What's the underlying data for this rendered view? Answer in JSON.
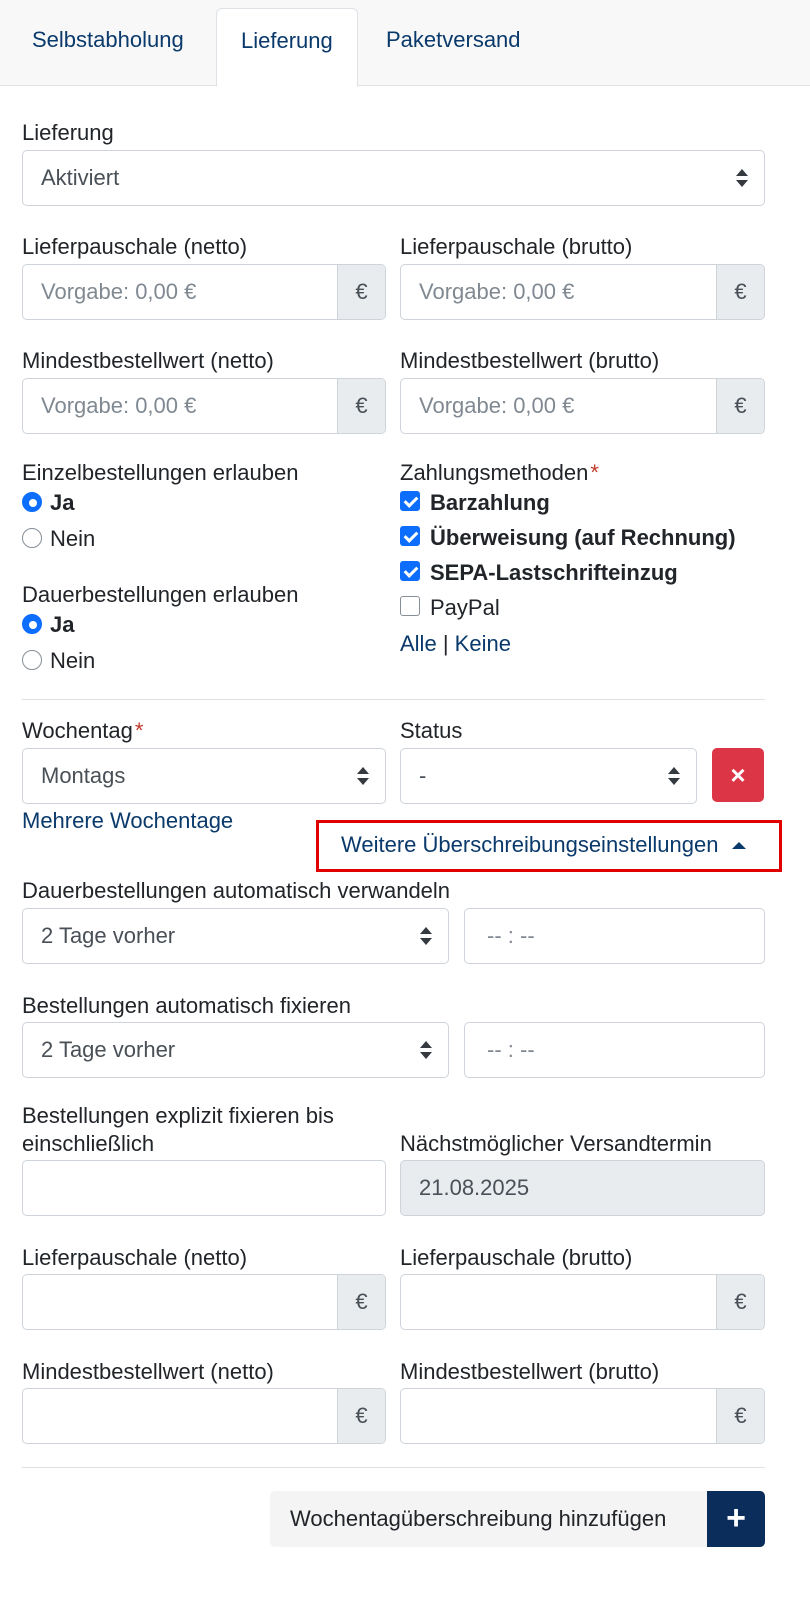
{
  "tabs": [
    {
      "label": "Selbstabholung",
      "active": false
    },
    {
      "label": "Lieferung",
      "active": true
    },
    {
      "label": "Paketversand",
      "active": false
    }
  ],
  "lieferung": {
    "label": "Lieferung",
    "value": "Aktiviert"
  },
  "defaults": {
    "lieferpauschale_netto": {
      "label": "Lieferpauschale (netto)",
      "placeholder": "Vorgabe: 0,00 €",
      "unit": "€"
    },
    "lieferpauschale_brutto": {
      "label": "Lieferpauschale (brutto)",
      "placeholder": "Vorgabe: 0,00 €",
      "unit": "€"
    },
    "mindestbestellwert_netto": {
      "label": "Mindestbestellwert (netto)",
      "placeholder": "Vorgabe: 0,00 €",
      "unit": "€"
    },
    "mindestbestellwert_brutto": {
      "label": "Mindestbestellwert (brutto)",
      "placeholder": "Vorgabe: 0,00 €",
      "unit": "€"
    }
  },
  "einzelbestellungen": {
    "label": "Einzelbestellungen erlauben",
    "options": [
      "Ja",
      "Nein"
    ],
    "selected": "Ja"
  },
  "dauerbestellungen": {
    "label": "Dauerbestellungen erlauben",
    "options": [
      "Ja",
      "Nein"
    ],
    "selected": "Ja"
  },
  "zahlungsmethoden": {
    "label": "Zahlungsmethoden",
    "required_mark": "*",
    "options": [
      {
        "label": "Barzahlung",
        "checked": true
      },
      {
        "label": "Überweisung (auf Rechnung)",
        "checked": true
      },
      {
        "label": "SEPA-Lastschrifteinzug",
        "checked": true
      },
      {
        "label": "PayPal",
        "checked": false
      }
    ],
    "all_link": "Alle",
    "separator": "|",
    "none_link": "Keine"
  },
  "override": {
    "wochentag_label": "Wochentag",
    "required_mark": "*",
    "wochentag_value": "Montags",
    "status_label": "Status",
    "status_value": "-",
    "remove_icon": "×",
    "mehrere_link": "Mehrere Wochentage",
    "weitere_link": "Weitere Überschreibungseinstellungen",
    "dauer_verwandeln_label": "Dauerbestellungen automatisch verwandeln",
    "dauer_verwandeln_value": "2 Tage vorher",
    "dauer_verwandeln_time": "-- : --",
    "auto_fixieren_label": "Bestellungen automatisch fixieren",
    "auto_fixieren_value": "2 Tage vorher",
    "auto_fixieren_time": "-- : --",
    "explizit_label_line1": "Bestellungen explizit fixieren bis",
    "explizit_label_line2": "einschließlich",
    "explizit_value": "",
    "naechster_label": "Nächstmöglicher Versandtermin",
    "naechster_value": "21.08.2025",
    "lieferpauschale_netto_label": "Lieferpauschale (netto)",
    "lieferpauschale_brutto_label": "Lieferpauschale (brutto)",
    "mindestbestellwert_netto_label": "Mindestbestellwert (netto)",
    "mindestbestellwert_brutto_label": "Mindestbestellwert (brutto)",
    "unit": "€"
  },
  "add_button": {
    "label": "Wochentagüberschreibung hinzufügen",
    "icon": "+"
  }
}
